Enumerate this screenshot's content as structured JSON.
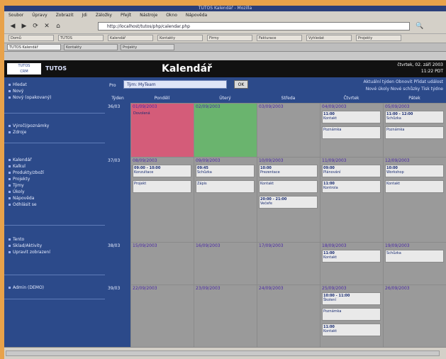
{
  "window": {
    "title": "TUTOS Kalendář - Mozilla"
  },
  "menu": [
    "Soubor",
    "Úpravy",
    "Zobrazit",
    "Jdi",
    "Záložky",
    "Přejít",
    "Nástroje",
    "Okno",
    "Nápověda"
  ],
  "url": "http://localhost/tutos/php/calendar.php",
  "bookmarks": [
    "Domů",
    "TUTOS",
    "Kalendář",
    "Kontakty",
    "Firmy",
    "Fakturace",
    "Vyhledat",
    "Projekty"
  ],
  "tabs": [
    {
      "label": "TUTOS Kalendář",
      "active": true
    },
    {
      "label": "Kontakty",
      "active": false
    },
    {
      "label": "Projekty",
      "active": false
    }
  ],
  "header": {
    "app_name": "TUTOS",
    "logo_line1": "TUTOS",
    "logo_line2": "CRM",
    "page_title": "Kalendář",
    "date_line1": "čtvrtek, 02. září 2003",
    "date_line2": "11:22 PDT"
  },
  "sidebar": {
    "groups": [
      {
        "items": [
          "Hledat",
          "Nový",
          "Nový (opakovaný)"
        ]
      },
      {
        "items": [
          "Výročí/poznámky",
          "Zdroje"
        ]
      },
      {
        "items": [
          "Kalendář",
          "Kalkul",
          "Produkty/zboží",
          "Projekty",
          "Týmy",
          "Úkoly",
          "Nápověda",
          "Odhlásit se"
        ]
      },
      {
        "items": [
          "Tento",
          "Sklad/Aktivity",
          "Upravit zobrazení"
        ]
      },
      {
        "items": [
          "Admin (DEMO)"
        ]
      }
    ]
  },
  "controls": {
    "pro_label": "Pro",
    "select_value": "Tým: MyTeam",
    "go_label": "OK",
    "link_line1": "Aktuální týden  Obnovit  Přidat událost",
    "link_line2": "Nové úkoly  Nové schůzky  Tisk týdne"
  },
  "days": [
    "Týden",
    "Pondělí",
    "Úterý",
    "Středa",
    "Čtvrtek",
    "Pátek"
  ],
  "weeks": [
    {
      "wk": "36/03",
      "cells": [
        {
          "date": "01/09/2003",
          "events": [
            {
              "label": "Dovolená"
            }
          ]
        },
        {
          "date": "02/09/2003",
          "events": []
        },
        {
          "date": "03/09/2003",
          "events": []
        },
        {
          "date": "04/09/2003",
          "events": [
            {
              "time": "11:00",
              "text": "Kontakt"
            },
            {
              "time": "",
              "text": "Poznámka"
            }
          ]
        },
        {
          "date": "05/09/2003",
          "events": [
            {
              "time": "11:00 - 12:00",
              "text": "Schůzka"
            },
            {
              "time": "",
              "text": "Poznámka"
            }
          ]
        }
      ]
    },
    {
      "wk": "37/03",
      "cells": [
        {
          "date": "08/09/2003",
          "events": [
            {
              "time": "09:00 - 10:00",
              "text": "Konzultace"
            },
            {
              "time": "",
              "text": "Projekt"
            }
          ]
        },
        {
          "date": "09/09/2003",
          "events": [
            {
              "time": "09:45",
              "text": "Schůzka"
            },
            {
              "time": "",
              "text": "Zápis"
            }
          ]
        },
        {
          "date": "10/09/2003",
          "events": [
            {
              "time": "10:00",
              "text": "Prezentace"
            },
            {
              "time": "",
              "text": "Kontakt"
            },
            {
              "time": "20:00 - 21:00",
              "text": "Večeře"
            }
          ]
        },
        {
          "date": "11/09/2003",
          "events": [
            {
              "time": "09:00",
              "text": "Plánování"
            },
            {
              "time": "11:00",
              "text": "Kontrola"
            }
          ]
        },
        {
          "date": "12/09/2003",
          "events": [
            {
              "time": "10:00",
              "text": "Workshop"
            },
            {
              "time": "",
              "text": "Kontakt"
            }
          ]
        }
      ]
    },
    {
      "wk": "38/03",
      "cells": [
        {
          "date": "15/09/2003",
          "events": []
        },
        {
          "date": "16/09/2003",
          "events": []
        },
        {
          "date": "17/09/2003",
          "events": []
        },
        {
          "date": "18/09/2003",
          "events": [
            {
              "time": "11:00",
              "text": "Kontakt"
            }
          ]
        },
        {
          "date": "19/09/2003",
          "events": [
            {
              "time": "",
              "text": "Schůzka"
            }
          ]
        }
      ]
    },
    {
      "wk": "39/03",
      "cells": [
        {
          "date": "22/09/2003",
          "events": []
        },
        {
          "date": "23/09/2003",
          "events": []
        },
        {
          "date": "24/09/2003",
          "events": []
        },
        {
          "date": "25/09/2003",
          "events": [
            {
              "time": "10:00 - 11:00",
              "text": "Školení"
            },
            {
              "time": "",
              "text": "Poznámka"
            },
            {
              "time": "11:00",
              "text": "Kontakt"
            }
          ]
        },
        {
          "date": "26/09/2003",
          "events": []
        }
      ]
    }
  ]
}
